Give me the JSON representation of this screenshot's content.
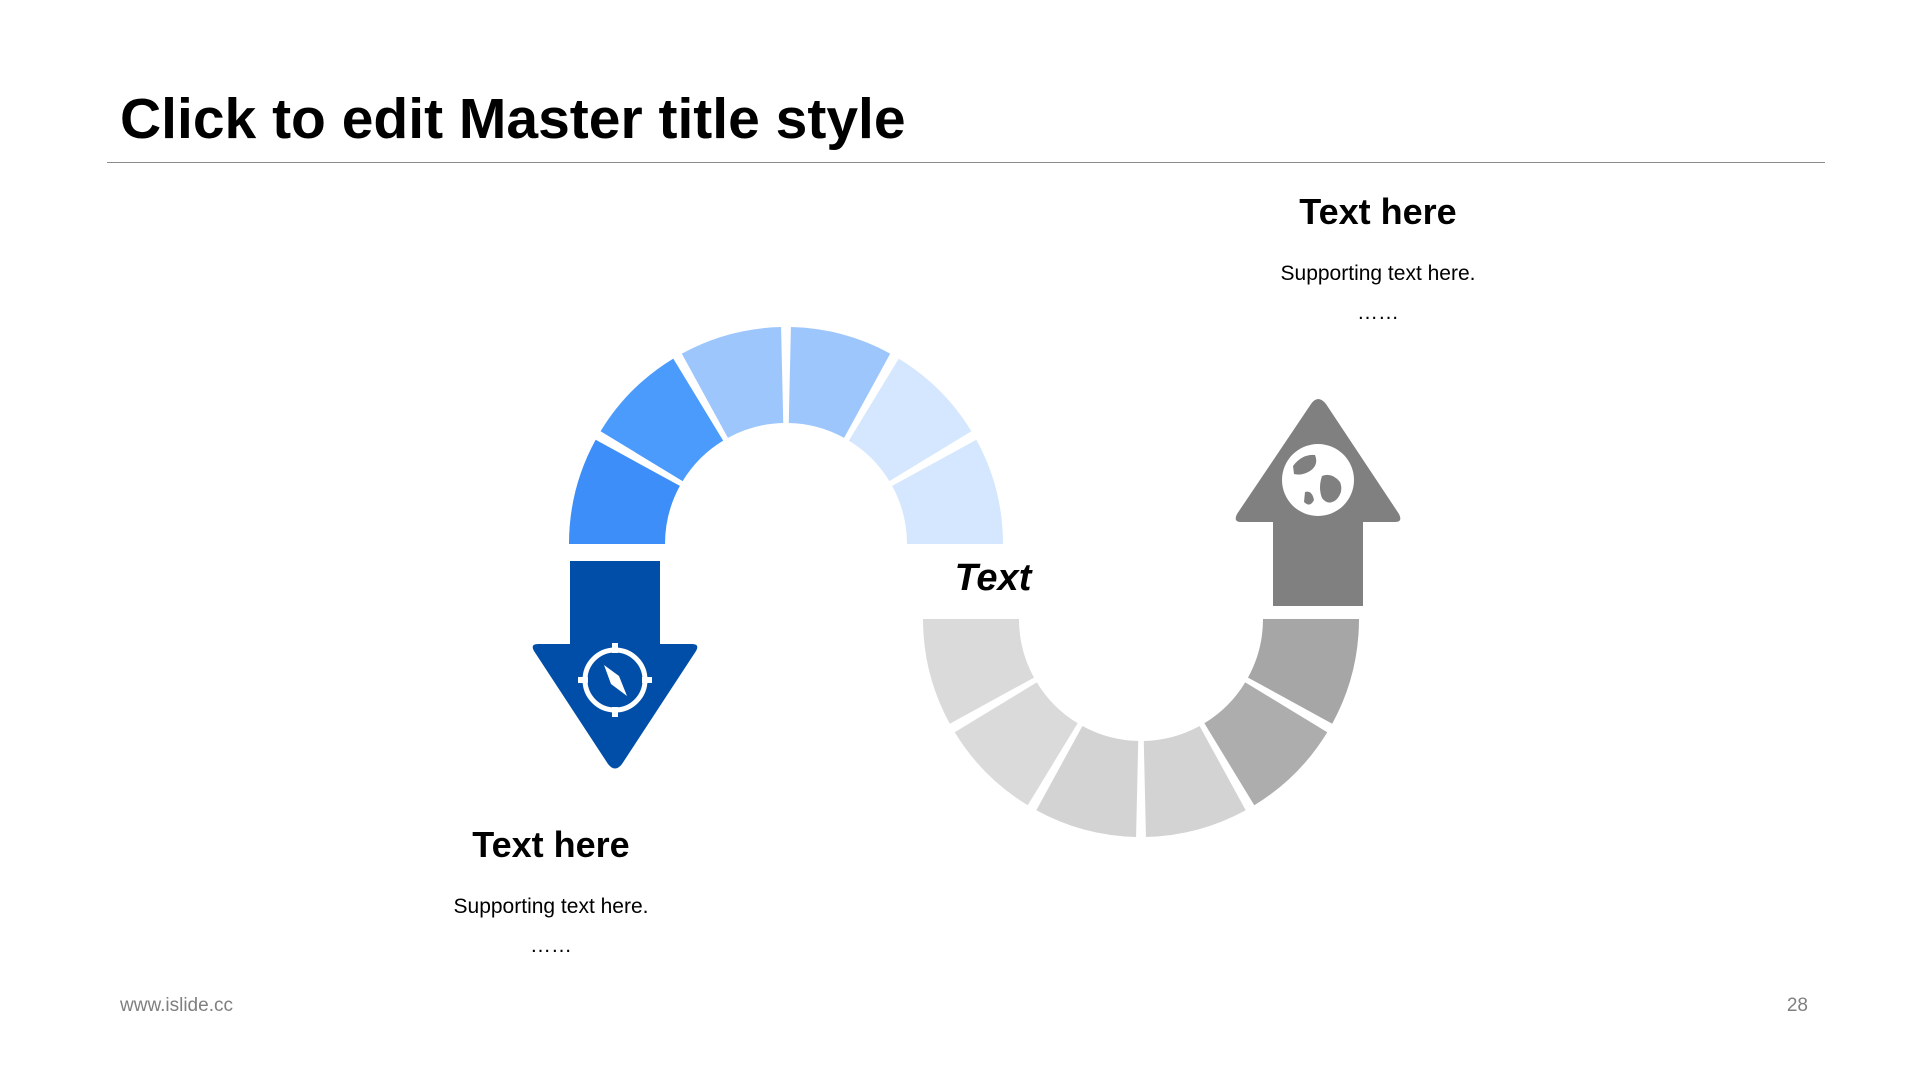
{
  "slide": {
    "title": "Click to edit Master title style",
    "center_label": "Text",
    "top_block": {
      "heading": "Text here",
      "body": "Supporting text here.",
      "ellipsis": "……"
    },
    "bottom_block": {
      "heading": "Text here",
      "body": "Supporting text here.",
      "ellipsis": "……"
    },
    "footer": {
      "url": "www.islide.cc",
      "page_number": "28"
    }
  },
  "colors": {
    "top_arc_segments": [
      "#3d8ef8",
      "#4a9bfb",
      "#9dc6fd",
      "#9dc6fd",
      "#d5e7fe",
      "#d5e7fe"
    ],
    "bottom_arc_segments": [
      "#dadada",
      "#dadada",
      "#d3d3d3",
      "#d3d3d3",
      "#adadad",
      "#a6a6a6"
    ],
    "down_arrow": "#004ea8",
    "up_arrow": "#808080",
    "icon_fill": "#ffffff",
    "rule": "#8c8c8c",
    "footer_text": "#7f7f7f"
  },
  "icons": {
    "down_arrow_icon": "compass-icon",
    "up_arrow_icon": "globe-icon"
  }
}
